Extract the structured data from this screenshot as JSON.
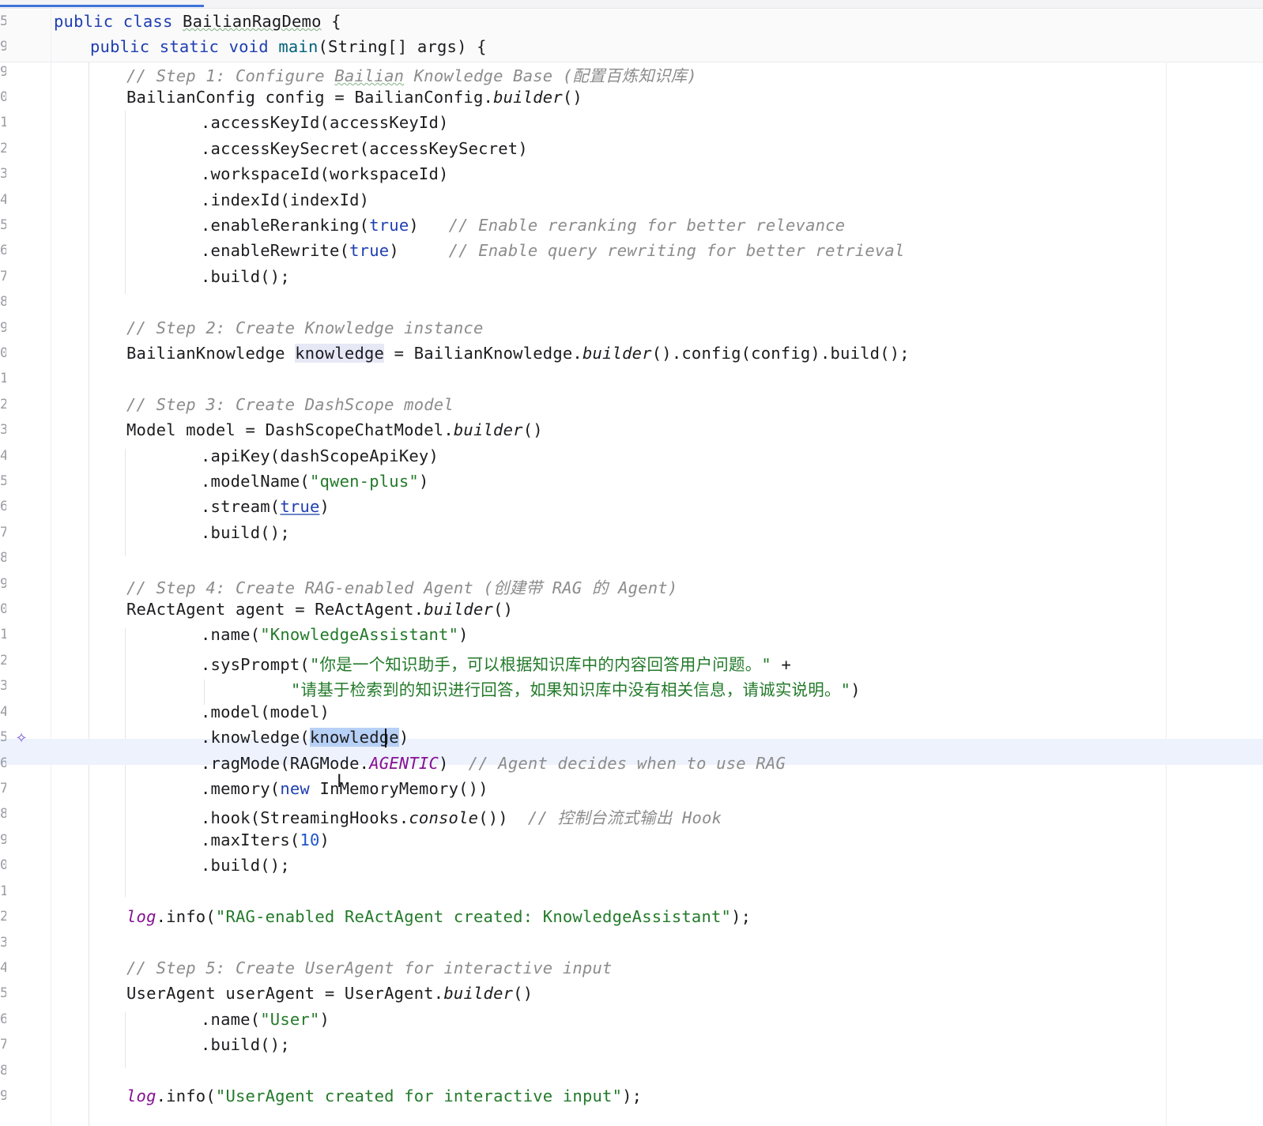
{
  "editor": {
    "ai_icon": "ai-assistant-icon",
    "lines": [
      {
        "n": "5",
        "tokens": [
          {
            "t": "public class ",
            "c": "kw"
          },
          {
            "t": "BailianRagDemo",
            "c": "wavy"
          },
          {
            "t": " {"
          }
        ]
      },
      {
        "n": "9",
        "tokens": [
          {
            "t": "public static void ",
            "c": "kw"
          },
          {
            "t": "main",
            "c": "fn"
          },
          {
            "t": "(String[] args) {"
          }
        ]
      },
      {
        "n": "9",
        "tokens": [
          {
            "t": "// Step 1: Configure ",
            "c": "cm"
          },
          {
            "t": "Bailian",
            "c": "cm wavy"
          },
          {
            "t": " Knowledge Base (配置百炼知识库)",
            "c": "cm"
          }
        ]
      },
      {
        "n": "0",
        "tokens": [
          {
            "t": "BailianConfig config = BailianConfig."
          },
          {
            "t": "builder",
            "c": "it"
          },
          {
            "t": "()"
          }
        ]
      },
      {
        "n": "1",
        "tokens": [
          {
            "t": ".accessKeyId(accessKeyId)"
          }
        ]
      },
      {
        "n": "2",
        "tokens": [
          {
            "t": ".accessKeySecret(accessKeySecret)"
          }
        ]
      },
      {
        "n": "3",
        "tokens": [
          {
            "t": ".workspaceId(workspaceId)"
          }
        ]
      },
      {
        "n": "4",
        "tokens": [
          {
            "t": ".indexId(indexId)"
          }
        ]
      },
      {
        "n": "5",
        "tokens": [
          {
            "t": ".enableReranking("
          },
          {
            "t": "true",
            "c": "kw"
          },
          {
            "t": ")   "
          },
          {
            "t": "// Enable reranking for better relevance",
            "c": "cm"
          }
        ]
      },
      {
        "n": "6",
        "tokens": [
          {
            "t": ".enableRewrite("
          },
          {
            "t": "true",
            "c": "kw"
          },
          {
            "t": ")     "
          },
          {
            "t": "// Enable query rewriting for better retrieval",
            "c": "cm"
          }
        ]
      },
      {
        "n": "7",
        "tokens": [
          {
            "t": ".build();"
          }
        ]
      },
      {
        "n": "8",
        "tokens": []
      },
      {
        "n": "9",
        "tokens": [
          {
            "t": "// Step 2: Create Knowledge instance",
            "c": "cm"
          }
        ]
      },
      {
        "n": "0",
        "tokens": [
          {
            "t": "BailianKnowledge "
          },
          {
            "t": "knowledge",
            "c": "vref"
          },
          {
            "t": " = BailianKnowledge."
          },
          {
            "t": "builder",
            "c": "it"
          },
          {
            "t": "().config(config).build();"
          }
        ]
      },
      {
        "n": "1",
        "tokens": []
      },
      {
        "n": "2",
        "tokens": [
          {
            "t": "// Step 3: Create DashScope model",
            "c": "cm"
          }
        ]
      },
      {
        "n": "3",
        "tokens": [
          {
            "t": "Model model = DashScopeChatModel."
          },
          {
            "t": "builder",
            "c": "it"
          },
          {
            "t": "()"
          }
        ]
      },
      {
        "n": "4",
        "tokens": [
          {
            "t": ".apiKey(dashScopeApiKey)"
          }
        ]
      },
      {
        "n": "5",
        "tokens": [
          {
            "t": ".modelName("
          },
          {
            "t": "\"qwen-plus\"",
            "c": "str"
          },
          {
            "t": ")"
          }
        ]
      },
      {
        "n": "6",
        "tokens": [
          {
            "t": ".stream("
          },
          {
            "t": "true",
            "c": "kw ulink"
          },
          {
            "t": ")"
          }
        ]
      },
      {
        "n": "7",
        "tokens": [
          {
            "t": ".build();"
          }
        ]
      },
      {
        "n": "8",
        "tokens": []
      },
      {
        "n": "9",
        "tokens": [
          {
            "t": "// Step 4: Create RAG-enabled Agent (创建带 RAG 的 Agent)",
            "c": "cm"
          }
        ]
      },
      {
        "n": "0",
        "tokens": [
          {
            "t": "ReActAgent agent = ReActAgent."
          },
          {
            "t": "builder",
            "c": "it"
          },
          {
            "t": "()"
          }
        ]
      },
      {
        "n": "1",
        "tokens": [
          {
            "t": ".name("
          },
          {
            "t": "\"KnowledgeAssistant\"",
            "c": "str"
          },
          {
            "t": ")"
          }
        ]
      },
      {
        "n": "2",
        "tokens": [
          {
            "t": ".sysPrompt("
          },
          {
            "t": "\"你是一个知识助手，可以根据知识库中的内容回答用户问题。\"",
            "c": "str"
          },
          {
            "t": " +"
          }
        ]
      },
      {
        "n": "3",
        "tokens": [
          {
            "t": "\"请基于检索到的知识进行回答，如果知识库中没有相关信息，请诚实说明。\"",
            "c": "str"
          },
          {
            "t": ")"
          }
        ]
      },
      {
        "n": "4",
        "tokens": [
          {
            "t": ".model(model)"
          }
        ]
      },
      {
        "n": "5",
        "tokens": [
          {
            "t": ".knowledge("
          },
          {
            "t": "knowledge",
            "c": "sel"
          },
          {
            "t": ")"
          }
        ]
      },
      {
        "n": "6",
        "tokens": [
          {
            "t": ".ragMode(RAGMode."
          },
          {
            "t": "AGENTIC",
            "c": "const"
          },
          {
            "t": ")  "
          },
          {
            "t": "// Agent decides when to use RAG",
            "c": "cm"
          }
        ]
      },
      {
        "n": "7",
        "tokens": [
          {
            "t": ".memory("
          },
          {
            "t": "new",
            "c": "kw"
          },
          {
            "t": " InMemoryMemory())"
          }
        ]
      },
      {
        "n": "8",
        "tokens": [
          {
            "t": ".hook(StreamingHooks."
          },
          {
            "t": "console",
            "c": "it"
          },
          {
            "t": "())  "
          },
          {
            "t": "// 控制台流式输出 Hook",
            "c": "cm"
          }
        ]
      },
      {
        "n": "9",
        "tokens": [
          {
            "t": ".maxIters("
          },
          {
            "t": "10",
            "c": "num"
          },
          {
            "t": ")"
          }
        ]
      },
      {
        "n": "0",
        "tokens": [
          {
            "t": ".build();"
          }
        ]
      },
      {
        "n": "1",
        "tokens": []
      },
      {
        "n": "2",
        "tokens": [
          {
            "t": "log",
            "c": "lg"
          },
          {
            "t": ".info("
          },
          {
            "t": "\"RAG-enabled ReActAgent created: KnowledgeAssistant\"",
            "c": "str"
          },
          {
            "t": ");"
          }
        ]
      },
      {
        "n": "3",
        "tokens": []
      },
      {
        "n": "4",
        "tokens": [
          {
            "t": "// Step 5: Create UserAgent for interactive input",
            "c": "cm"
          }
        ]
      },
      {
        "n": "5",
        "tokens": [
          {
            "t": "UserAgent userAgent = UserAgent."
          },
          {
            "t": "builder",
            "c": "it"
          },
          {
            "t": "()"
          }
        ]
      },
      {
        "n": "6",
        "tokens": [
          {
            "t": ".name("
          },
          {
            "t": "\"User\"",
            "c": "str"
          },
          {
            "t": ")"
          }
        ]
      },
      {
        "n": "7",
        "tokens": [
          {
            "t": ".build();"
          }
        ]
      },
      {
        "n": "8",
        "tokens": []
      },
      {
        "n": "9",
        "tokens": [
          {
            "t": "log",
            "c": "lg"
          },
          {
            "t": ".info("
          },
          {
            "t": "\"UserAgent created for interactive input\"",
            "c": "str"
          },
          {
            "t": ");"
          }
        ]
      }
    ]
  }
}
